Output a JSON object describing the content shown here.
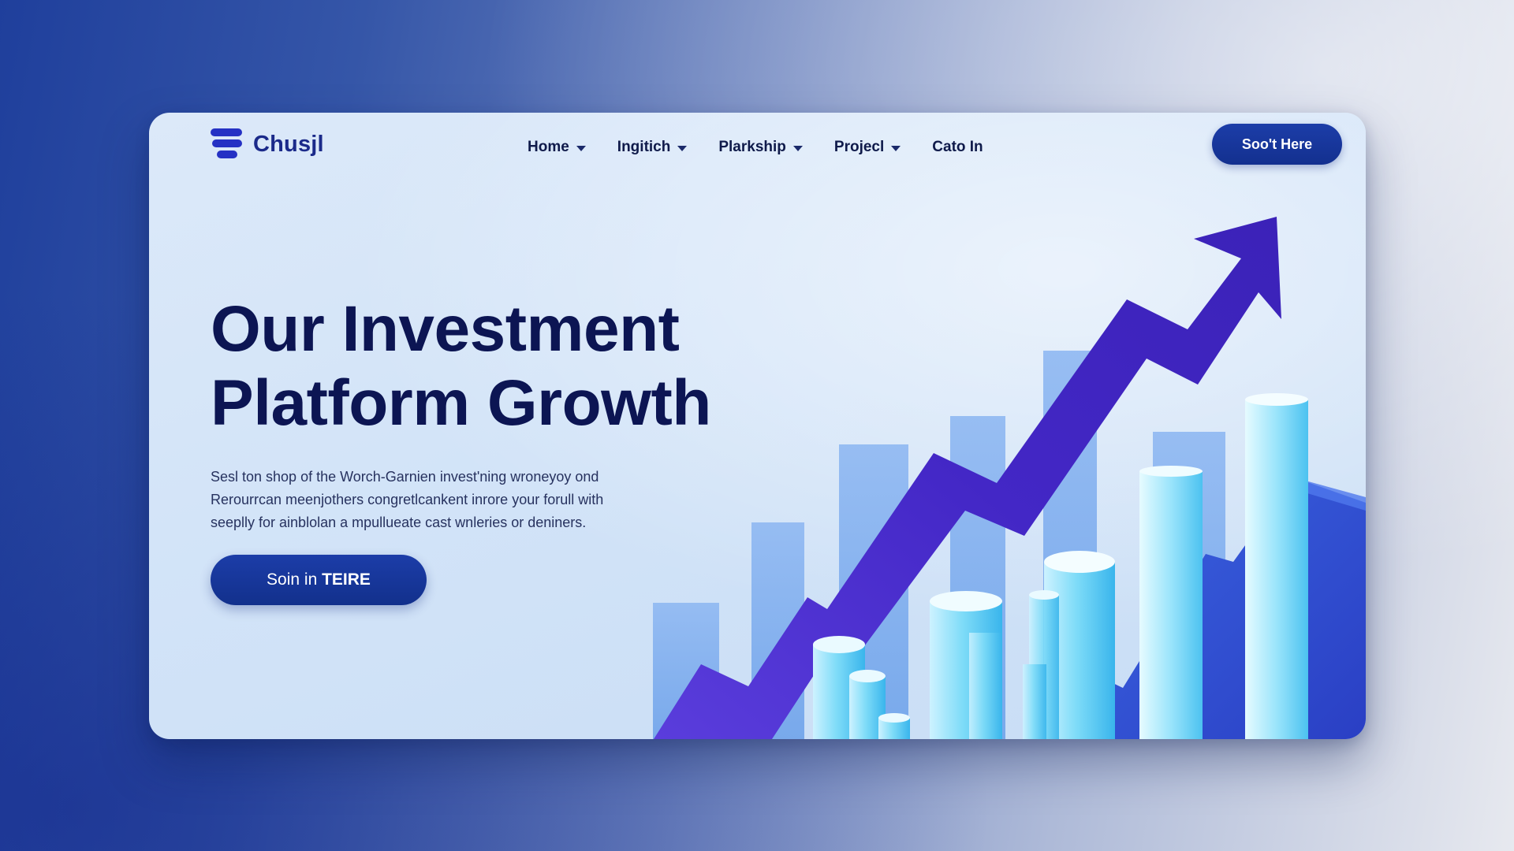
{
  "brand": {
    "name": "Chusjl",
    "logo_icon": "stacked-bars-logo-icon"
  },
  "nav": {
    "items": [
      {
        "label": "Home",
        "has_dropdown": true
      },
      {
        "label": "Ingitich",
        "has_dropdown": true
      },
      {
        "label": "Plarkship",
        "has_dropdown": true
      },
      {
        "label": "Projecl",
        "has_dropdown": true
      },
      {
        "label": "Cato In",
        "has_dropdown": false
      }
    ],
    "cta_label": "Soo't Here"
  },
  "hero": {
    "title_line1": "Our Investment",
    "title_line2": "Platform Growth",
    "description_lines": [
      "Sesl ton shop of the Worch-Garnien invest'ning wroneyoy ond",
      "Rerourrcan meenjothers congretlcankent inrore your forull with",
      "seeplly for ainblolan a mpullueate cast wnleries or deniners."
    ],
    "cta_prefix": "Soin in ",
    "cta_emphasis": "TEIRE"
  },
  "illustration": {
    "subject": "rising-growth-arrow-over-bar-chart",
    "colors": {
      "arrow": "#4a2fd0",
      "bars": "#7aaef0",
      "cylinders": "#5cc8f0",
      "mountain": "#2e4fd0"
    }
  },
  "colors": {
    "primary": "#13308f",
    "heading": "#0c1553",
    "card_bg": "#d3e4f8"
  }
}
